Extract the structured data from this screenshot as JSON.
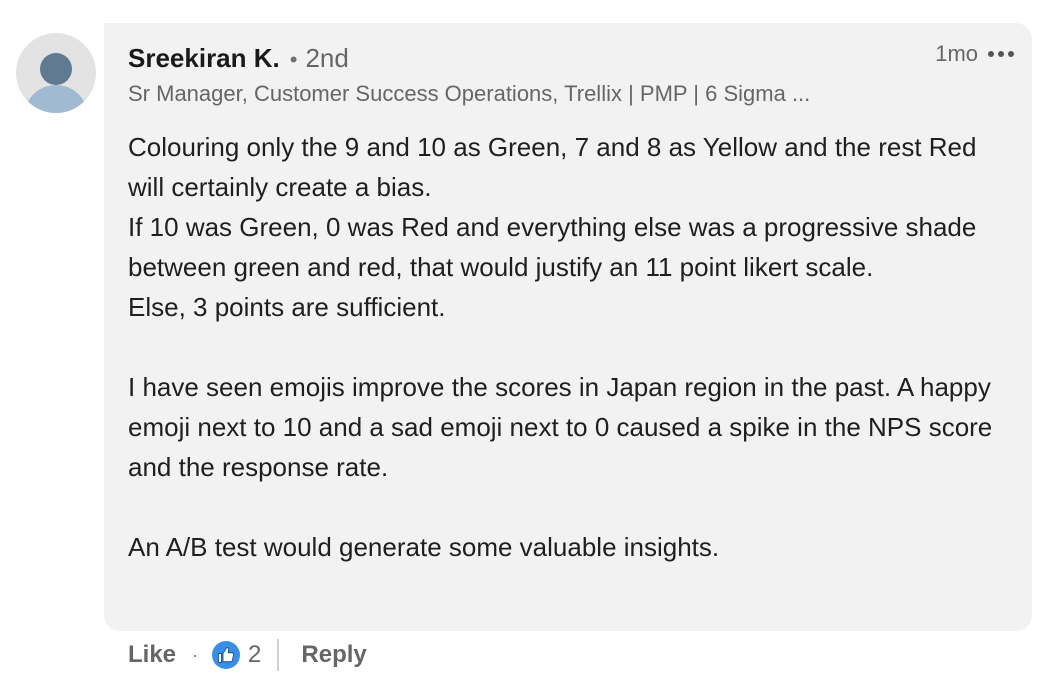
{
  "comment": {
    "author": {
      "name": "Sreekiran K.",
      "degree_separator": "•",
      "degree": "2nd",
      "headline": "Sr Manager, Customer Success Operations, Trellix | PMP | 6 Sigma ..."
    },
    "timestamp": "1mo",
    "paragraphs": [
      "Colouring only the 9 and 10 as Green, 7 and 8 as Yellow and the rest Red will certainly create a bias.",
      "If 10 was Green, 0 was Red and everything else was a progressive shade between green and red, that would justify an 11 point likert scale.",
      "Else, 3 points are sufficient.",
      "I have seen emojis improve the scores in Japan region in the past. A happy emoji next to 10 and a sad emoji next to 0 caused a spike in the NPS score and the response rate.",
      "An A/B test would generate some valuable insights."
    ]
  },
  "actions": {
    "like_label": "Like",
    "dot": "·",
    "reaction_icon": "thumbs-up-icon",
    "reaction_count": "2",
    "reply_label": "Reply"
  },
  "colors": {
    "bubble_bg": "#f2f2f2",
    "like_icon_bg": "#378fe9",
    "muted_text": "#666666"
  }
}
